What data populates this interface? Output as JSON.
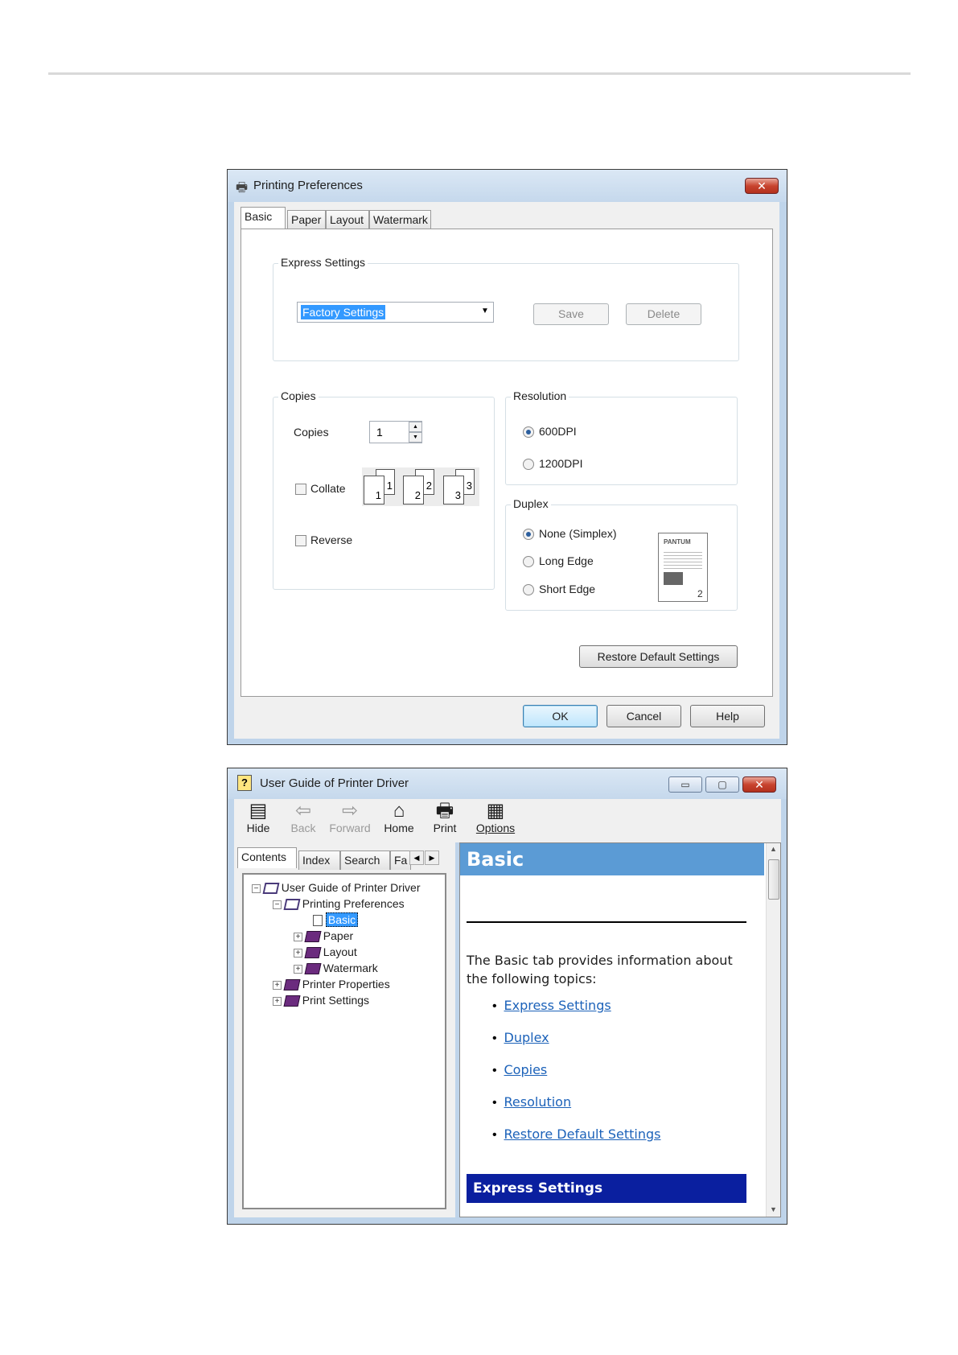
{
  "dialog": {
    "title": "Printing Preferences",
    "tabs": [
      "Basic",
      "Paper",
      "Layout",
      "Watermark"
    ],
    "express": {
      "group_label": "Express Settings",
      "selected": "Factory Settings",
      "save_label": "Save",
      "delete_label": "Delete"
    },
    "copies": {
      "group_label": "Copies",
      "label": "Copies",
      "value": "1",
      "collate_label": "Collate",
      "reverse_label": "Reverse",
      "pages": [
        "1",
        "1",
        "2",
        "2",
        "3",
        "3"
      ]
    },
    "resolution": {
      "group_label": "Resolution",
      "options": [
        "600DPI",
        "1200DPI"
      ],
      "selected": "600DPI"
    },
    "duplex": {
      "group_label": "Duplex",
      "options": [
        "None (Simplex)",
        "Long Edge",
        "Short Edge"
      ],
      "selected": "None (Simplex)",
      "preview_brand": "PANTUM",
      "preview_page": "2"
    },
    "restore_label": "Restore Default Settings",
    "ok_label": "OK",
    "cancel_label": "Cancel",
    "help_label": "Help"
  },
  "guide": {
    "title": "User Guide of Printer Driver",
    "toolbar": [
      "Hide",
      "Back",
      "Forward",
      "Home",
      "Print",
      "Options"
    ],
    "nav_tabs": [
      "Contents",
      "Index",
      "Search",
      "Fa"
    ],
    "tree": {
      "root": "User Guide of Printer Driver",
      "printing_preferences": "Printing Preferences",
      "basic": "Basic",
      "paper": "Paper",
      "layout": "Layout",
      "watermark": "Watermark",
      "printer_properties": "Printer Properties",
      "print_settings": "Print Settings"
    },
    "content": {
      "heading": "Basic",
      "intro": "The Basic tab provides information about the following topics:",
      "links": [
        "Express Settings",
        "Duplex",
        "Copies",
        "Resolution",
        "Restore Default Settings"
      ],
      "section_heading": "Express Settings"
    },
    "colors": {
      "heading_bg": "#5b9bd5",
      "section_bg": "#0a1f9f",
      "link": "#1c62b9"
    }
  }
}
